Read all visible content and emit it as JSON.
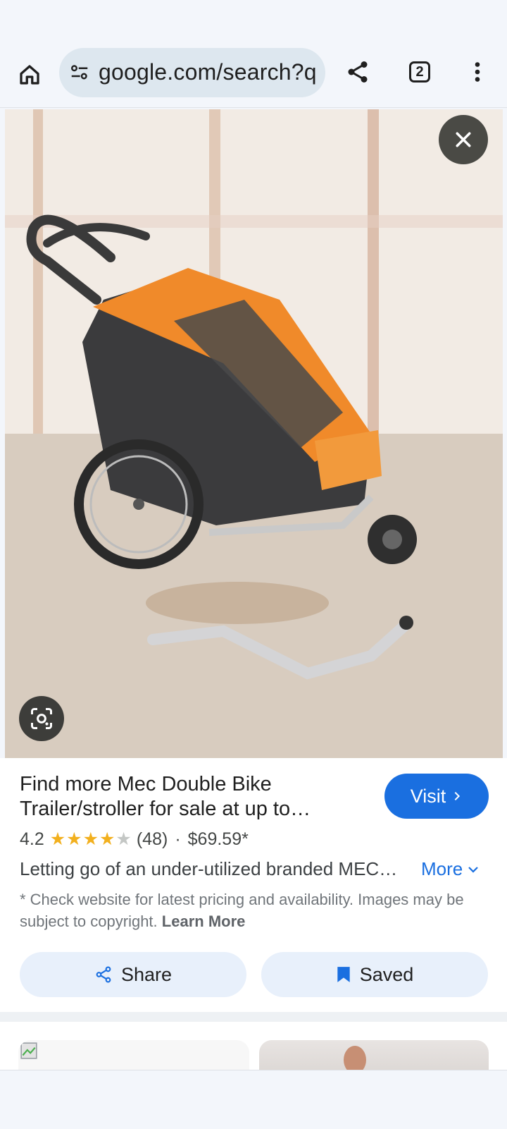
{
  "browser": {
    "url": "google.com/search?q",
    "tab_count": "2"
  },
  "result": {
    "title": "Find more Mec Double Bike Trailer/stroller for sale at up to…",
    "visit_label": "Visit",
    "rating": "4.2",
    "rating_value": 4.2,
    "review_count": "(48)",
    "separator": "·",
    "price": "$69.59*",
    "description": "Letting go of an under-utilized branded MEC…",
    "more_label": "More",
    "disclaimer": "* Check website for latest pricing and availability. Images may be subject to copyright.",
    "learn_more": "Learn More",
    "share_label": "Share",
    "saved_label": "Saved"
  },
  "colors": {
    "accent": "#1a6fe0",
    "star": "#f2b01e",
    "trailer_orange": "#f08a2a"
  },
  "icons": [
    "home-icon",
    "tune-icon",
    "share-icon",
    "tabs-icon",
    "more-vert-icon",
    "close-icon",
    "lens-icon",
    "chevron-right-icon",
    "chevron-down-icon",
    "bookmark-icon"
  ]
}
